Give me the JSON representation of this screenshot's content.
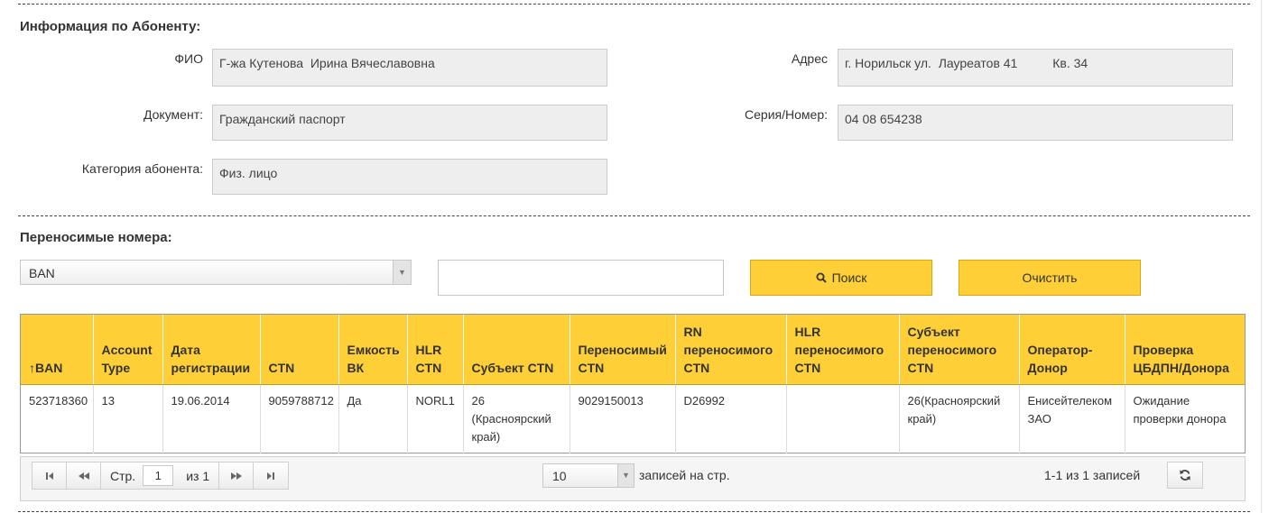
{
  "subscriber": {
    "title": "Информация по Абоненту:",
    "fio_label": "ФИО",
    "fio_value": "Г-жа Кутенова  Ирина Вячеславовна",
    "address_label": "Адрес",
    "address_value": "г. Норильск ул.  Лауреатов 41          Кв. 34",
    "document_label": "Документ:",
    "document_value": "Гражданский паспорт",
    "series_label": "Серия/Номер:",
    "series_value": "04 08 654238",
    "category_label": "Категория абонента:",
    "category_value": "Физ. лицо"
  },
  "numbers": {
    "title": "Переносимые номера:",
    "filter_select": "BAN",
    "search_value": "",
    "search_button": "Поиск",
    "clear_button": "Очистить",
    "columns": [
      [
        "↑BAN"
      ],
      [
        "Account",
        "Type"
      ],
      [
        "Дата",
        "регистрации"
      ],
      [
        "CTN"
      ],
      [
        "Емкость",
        "ВК"
      ],
      [
        "HLR",
        "CTN"
      ],
      [
        "Субъект CTN"
      ],
      [
        "Переносимый",
        "CTN"
      ],
      [
        "RN",
        "переносимого",
        "CTN"
      ],
      [
        "HLR",
        "переносимого",
        "CTN"
      ],
      [
        "Субъект",
        "переносимого",
        "CTN"
      ],
      [
        "Оператор-",
        "Донор"
      ],
      [
        "Проверка",
        "ЦБДПН/Донора"
      ]
    ],
    "rows": [
      [
        [
          "523718360"
        ],
        [
          "13"
        ],
        [
          "19.06.2014"
        ],
        [
          "9059788712"
        ],
        [
          "Да"
        ],
        [
          "NORL1"
        ],
        [
          "26",
          "(Красноярский",
          "край)"
        ],
        [
          "9029150013"
        ],
        [
          "D26992"
        ],
        [
          ""
        ],
        [
          "26(Красноярский",
          "край)"
        ],
        [
          "Енисейтелеком",
          "ЗАО"
        ],
        [
          "Ожидание",
          "проверки донора"
        ]
      ]
    ]
  },
  "pager": {
    "page_label": "Стр.",
    "page_value": "1",
    "of_label": "из 1",
    "page_size": "10",
    "per_page_label": "записей на стр.",
    "summary": "1-1 из 1 записей"
  },
  "colors": {
    "accent": "#fecf37",
    "accent_border": "#d9a812",
    "field_bg": "#eeeeee"
  }
}
